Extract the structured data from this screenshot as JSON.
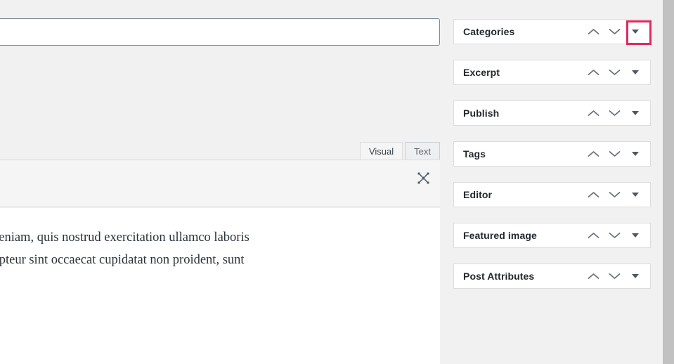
{
  "editor": {
    "title_value": "",
    "title_placeholder": "",
    "tabs": [
      {
        "label": "Visual",
        "active": true
      },
      {
        "label": "Text",
        "active": false
      }
    ],
    "fullscreen_icon": "fullscreen-expand-icon",
    "content_paragraph": "e magna aliqua. Ut enim ad minim veniam, quis nostrud exercitation ullamco laboris\n dolore eu fugiat nulla pariatur. Excepteur sint occaecat cupidatat non proident, sunt"
  },
  "sidebar": {
    "panels": [
      {
        "title": "Categories",
        "move_up": "move-up-icon",
        "move_down": "move-down-icon",
        "toggle": "toggle-panel-icon",
        "highlighted": true
      },
      {
        "title": "Excerpt",
        "move_up": "move-up-icon",
        "move_down": "move-down-icon",
        "toggle": "toggle-panel-icon",
        "highlighted": false
      },
      {
        "title": "Publish",
        "move_up": "move-up-icon",
        "move_down": "move-down-icon",
        "toggle": "toggle-panel-icon",
        "highlighted": false
      },
      {
        "title": "Tags",
        "move_up": "move-up-icon",
        "move_down": "move-down-icon",
        "toggle": "toggle-panel-icon",
        "highlighted": false
      },
      {
        "title": "Editor",
        "move_up": "move-up-icon",
        "move_down": "move-down-icon",
        "toggle": "toggle-panel-icon",
        "highlighted": false
      },
      {
        "title": "Featured image",
        "move_up": "move-up-icon",
        "move_down": "move-down-icon",
        "toggle": "toggle-panel-icon",
        "highlighted": false
      },
      {
        "title": "Post Attributes",
        "move_up": "move-up-icon",
        "move_down": "move-down-icon",
        "toggle": "toggle-panel-icon",
        "highlighted": false
      }
    ]
  },
  "colors": {
    "background": "#f1f1f1",
    "panel_background": "#ffffff",
    "panel_border": "#dcdcde",
    "text": "#23282d",
    "highlight": "#e02a5c",
    "scrollbar": "#c1c1c1"
  }
}
